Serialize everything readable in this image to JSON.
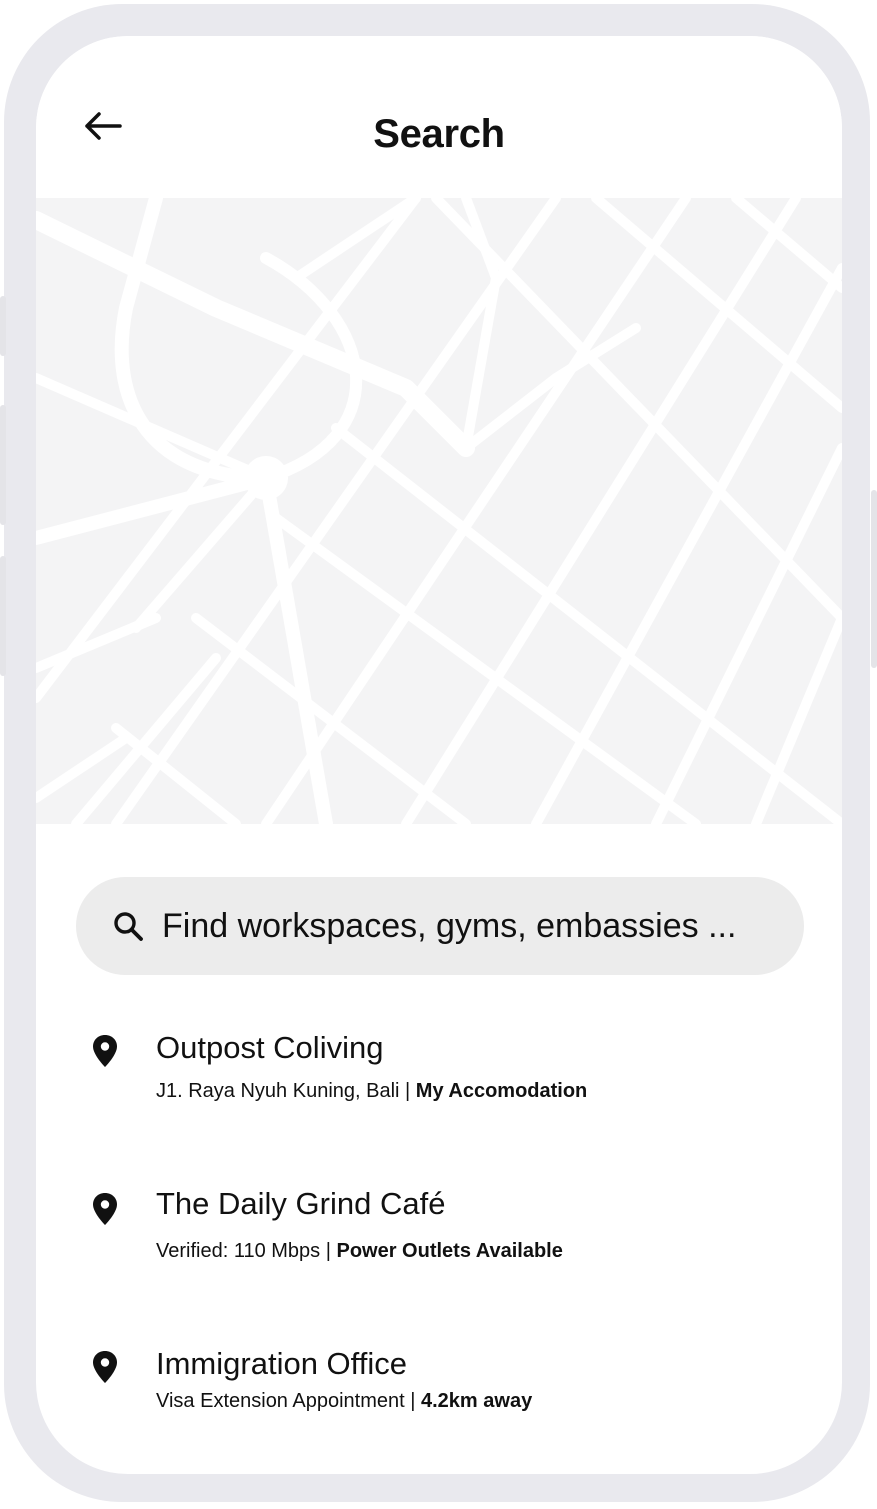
{
  "header": {
    "title": "Search",
    "back_icon": "arrow-left-icon"
  },
  "map": {
    "background_color": "#f4f4f5",
    "road_color": "#ffffff"
  },
  "search": {
    "placeholder": "Find workspaces, gyms, embassies ...",
    "value": "",
    "icon": "search-icon"
  },
  "results": [
    {
      "name": "Outpost Coliving",
      "detail_prefix": "J1. Raya Nyuh Kuning, Bali | ",
      "detail_bold": "My Accomodation",
      "icon": "map-pin-icon"
    },
    {
      "name": "The Daily Grind Café",
      "detail_prefix": "Verified: 110 Mbps | ",
      "detail_bold": "Power Outlets Available",
      "icon": "map-pin-icon"
    },
    {
      "name": "Immigration Office",
      "detail_prefix": "Visa Extension Appointment | ",
      "detail_bold": "4.2km away",
      "icon": "map-pin-icon"
    }
  ],
  "colors": {
    "frame": "#e9e9ee",
    "screen": "#ffffff",
    "search_bg": "#ececec",
    "text": "#111111"
  }
}
